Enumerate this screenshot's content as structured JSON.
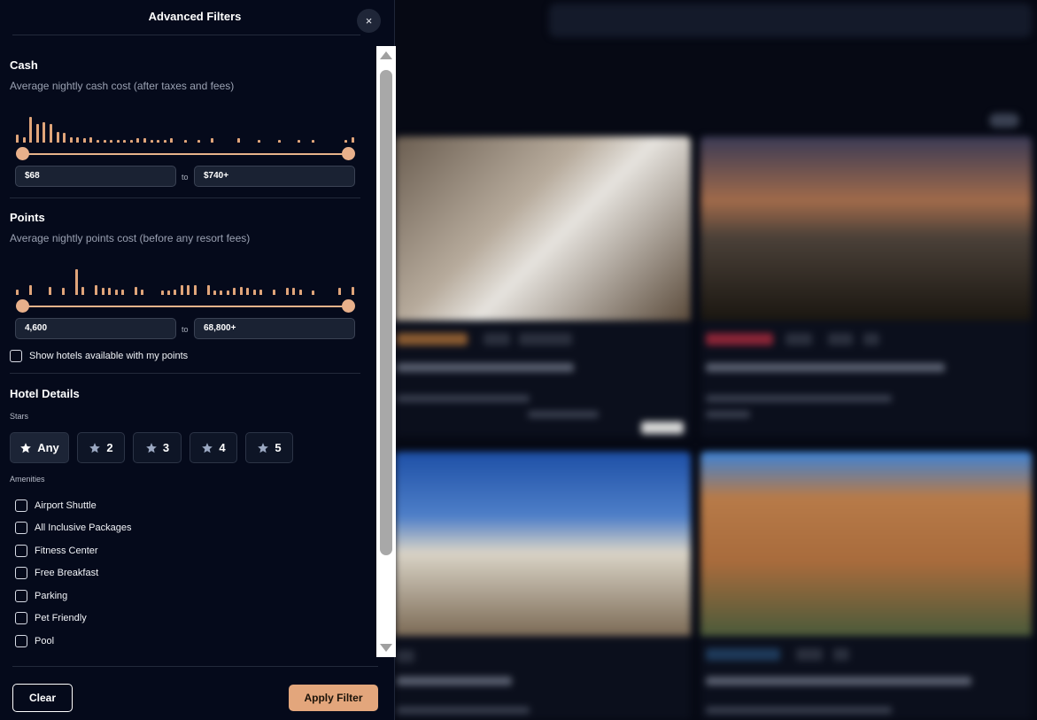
{
  "panel": {
    "title": "Advanced Filters",
    "close_label": "×"
  },
  "cash": {
    "title": "Cash",
    "subtitle": "Average nightly cash cost (after taxes and fees)",
    "min_value": "$68",
    "max_value": "$740+",
    "to_label": "to",
    "range_selected": [
      0,
      1
    ],
    "histogram": [
      0.3,
      0.2,
      0.95,
      0.7,
      0.75,
      0.7,
      0.4,
      0.35,
      0.2,
      0.2,
      0.15,
      0.2,
      0.1,
      0.1,
      0.1,
      0.1,
      0.1,
      0.1,
      0.15,
      0.15,
      0.1,
      0.1,
      0.1,
      0.15,
      0,
      0.1,
      0,
      0.1,
      0,
      0.15,
      0,
      0,
      0,
      0.15,
      0,
      0,
      0.1,
      0,
      0,
      0.05,
      0,
      0,
      0.05,
      0,
      0.05,
      0,
      0,
      0,
      0,
      0.1,
      0.2
    ]
  },
  "points": {
    "title": "Points",
    "subtitle": "Average nightly points cost (before any resort fees)",
    "min_value": "4,600",
    "max_value": "68,800+",
    "to_label": "to",
    "range_selected": [
      0,
      1
    ],
    "histogram": [
      0.2,
      0,
      0.35,
      0,
      0,
      0.3,
      0,
      0.25,
      0,
      0.95,
      0.3,
      0,
      0.35,
      0.25,
      0.25,
      0.2,
      0.2,
      0,
      0.3,
      0.2,
      0,
      0,
      0.15,
      0.15,
      0.2,
      0.35,
      0.35,
      0.35,
      0,
      0.35,
      0.15,
      0.15,
      0.15,
      0.25,
      0.3,
      0.25,
      0.2,
      0.2,
      0,
      0.2,
      0,
      0.25,
      0.25,
      0.2,
      0,
      0.15,
      0,
      0,
      0,
      0.25,
      0,
      0.3
    ],
    "checkbox_label": "Show hotels available with my points"
  },
  "hotel_details": {
    "title": "Hotel Details",
    "stars_label": "Stars",
    "stars": [
      {
        "label": "Any",
        "active": true
      },
      {
        "label": "2",
        "active": false
      },
      {
        "label": "3",
        "active": false
      },
      {
        "label": "4",
        "active": false
      },
      {
        "label": "5",
        "active": false
      }
    ],
    "amenities_label": "Amenities",
    "amenities": [
      "Airport Shuttle",
      "All Inclusive Packages",
      "Fitness Center",
      "Free Breakfast",
      "Parking",
      "Pet Friendly",
      "Pool"
    ]
  },
  "footer": {
    "clear_label": "Clear",
    "apply_label": "Apply Filter"
  },
  "colors": {
    "accent": "#e3a67c",
    "panel_bg": "#050a1b"
  }
}
